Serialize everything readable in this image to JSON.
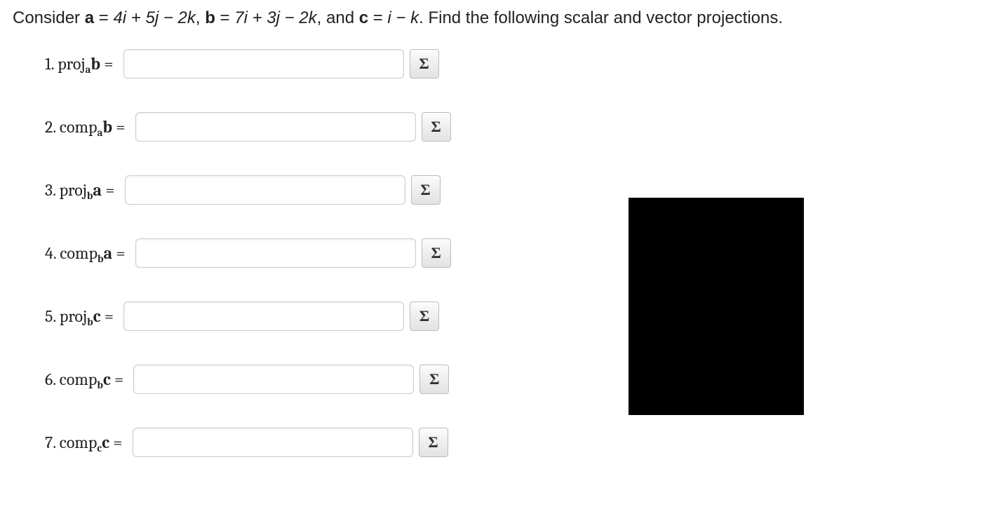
{
  "prompt": {
    "prefix": "Consider ",
    "a_lhs": "a",
    "eq": " = ",
    "a_rhs": "4i + 5j − 2k",
    "sep1": ", ",
    "b_lhs": "b",
    "b_rhs": "7i + 3j − 2k",
    "sep2": ", and ",
    "c_lhs": "c",
    "c_rhs": "i − k",
    "suffix": ". Find the following scalar and vector projections."
  },
  "sigma": "Σ",
  "questions": [
    {
      "num": "1.",
      "op": "proj",
      "sub": "a",
      "vec": "b"
    },
    {
      "num": "2.",
      "op": "comp",
      "sub": "a",
      "vec": "b"
    },
    {
      "num": "3.",
      "op": "proj",
      "sub": "b",
      "vec": "a"
    },
    {
      "num": "4.",
      "op": "comp",
      "sub": "b",
      "vec": "a"
    },
    {
      "num": "5.",
      "op": "proj",
      "sub": "b",
      "vec": "c"
    },
    {
      "num": "6.",
      "op": "comp",
      "sub": "b",
      "vec": "c"
    },
    {
      "num": "7.",
      "op": "comp",
      "sub": "c",
      "vec": "c"
    }
  ],
  "equals": " ="
}
